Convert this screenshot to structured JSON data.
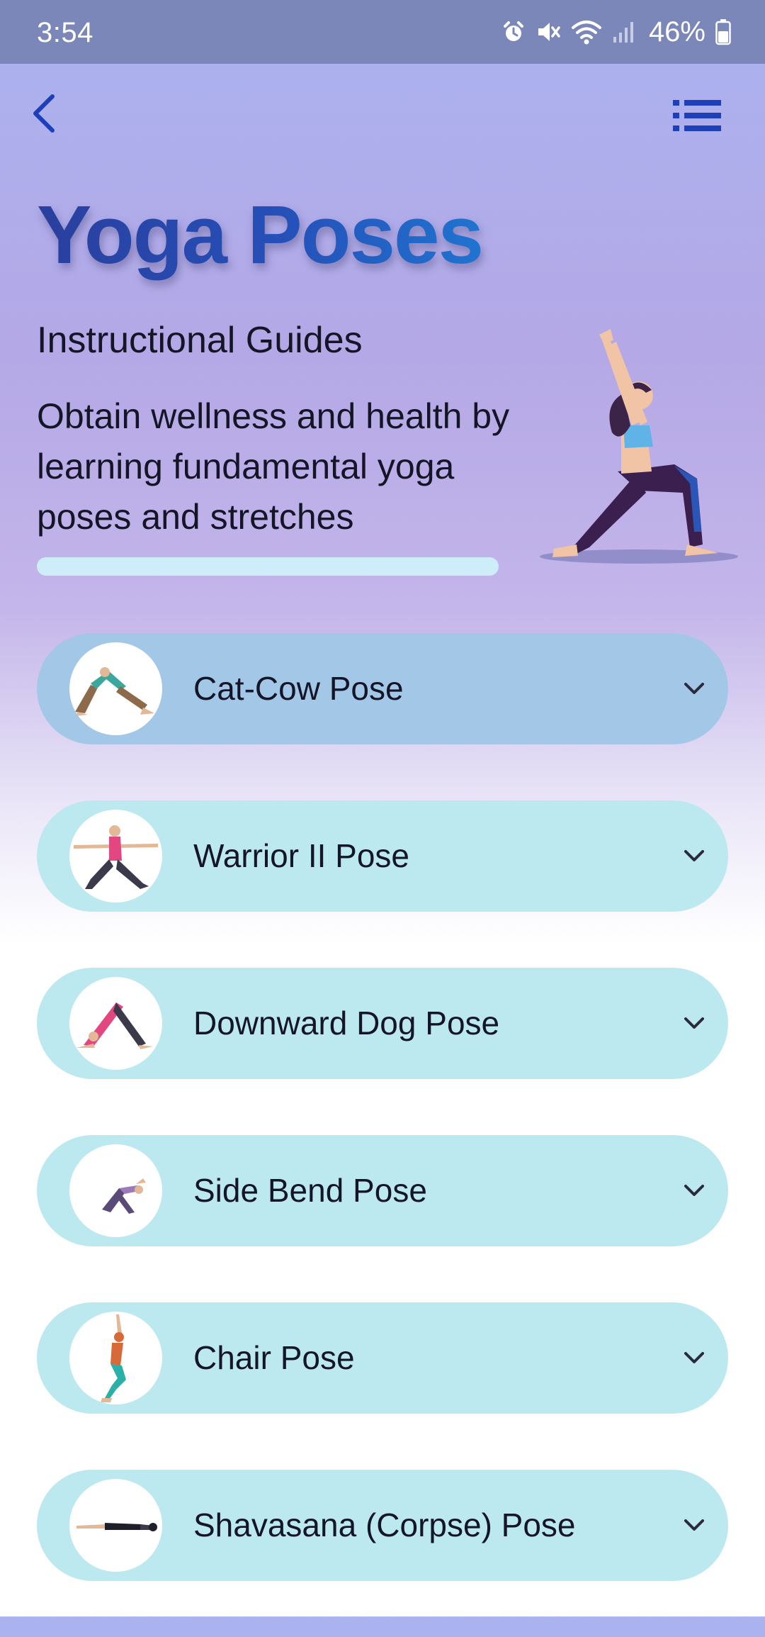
{
  "status_bar": {
    "time": "3:54",
    "battery": "46%",
    "icons": [
      "alarm-icon",
      "mute-icon",
      "wifi-icon",
      "signal-icon",
      "battery-icon"
    ]
  },
  "header": {
    "back_icon": "chevron-left-icon",
    "menu_icon": "list-menu-icon"
  },
  "hero": {
    "title": "Yoga Poses",
    "subtitle": "Instructional Guides",
    "description": "Obtain wellness and health by learning fundamental yoga poses and stretches"
  },
  "poses": [
    {
      "label": "Cat-Cow Pose"
    },
    {
      "label": "Warrior II Pose"
    },
    {
      "label": "Downward Dog Pose"
    },
    {
      "label": "Side Bend Pose"
    },
    {
      "label": "Chair Pose"
    },
    {
      "label": "Shavasana (Corpse) Pose"
    }
  ],
  "colors": {
    "accent_title": "#2a4fb0",
    "list_item_bg": "#bce9ef",
    "list_item_highlight_bg": "#a2c7e7",
    "progress_bar": "#cdeef9",
    "status_bar": "#7b86b9"
  }
}
